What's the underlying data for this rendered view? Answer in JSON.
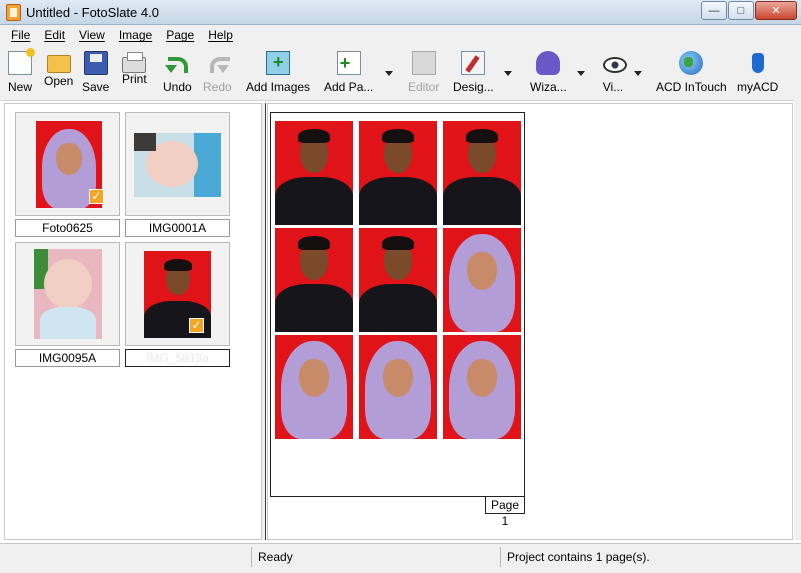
{
  "window": {
    "title": "Untitled - FotoSlate 4.0"
  },
  "menu": [
    "File",
    "Edit",
    "View",
    "Image",
    "Page",
    "Help"
  ],
  "toolbar": {
    "new": "New",
    "open": "Open",
    "save": "Save",
    "print": "Print",
    "undo": "Undo",
    "redo": "Redo",
    "add_images": "Add Images",
    "add_page": "Add Pa...",
    "editor": "Editor",
    "design": "Desig...",
    "wizard": "Wiza...",
    "view": "Vi...",
    "acd_intouch": "ACD InTouch",
    "myacd": "myACD"
  },
  "thumbnails": [
    {
      "label": "Foto0625",
      "checked": true
    },
    {
      "label": "IMG0001A",
      "checked": false
    },
    {
      "label": "IMG0095A",
      "checked": false
    },
    {
      "label": "IMG_5819a",
      "checked": true
    }
  ],
  "page": {
    "label": "Page 1"
  },
  "status": {
    "left": "",
    "middle": "Ready",
    "right": "Project contains 1 page(s)."
  }
}
